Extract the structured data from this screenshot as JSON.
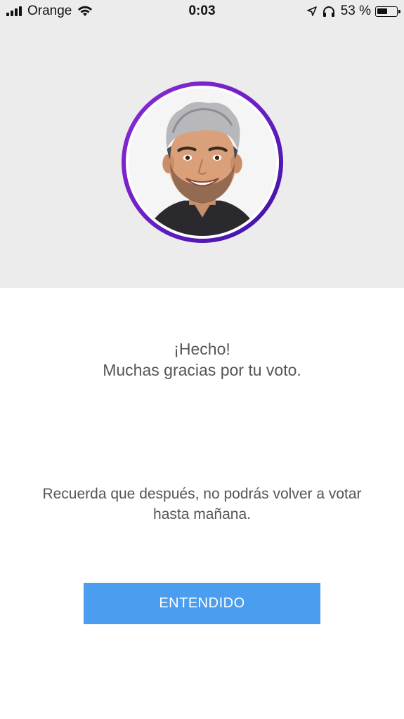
{
  "status_bar": {
    "carrier": "Orange",
    "time": "0:03",
    "battery_percent": "53 %",
    "battery_level": 0.53,
    "icons": [
      "signal-icon",
      "wifi-icon",
      "location-icon",
      "headphones-icon",
      "battery-icon"
    ]
  },
  "header": {
    "avatar_ring_colors": [
      "#8e2ad6",
      "#3a12a0"
    ],
    "background": "#ececec"
  },
  "confirmation": {
    "title": "¡Hecho!",
    "subtitle": "Muchas gracias por tu voto."
  },
  "reminder": {
    "text": "Recuerda que después, no podrás volver a votar hasta mañana."
  },
  "actions": {
    "confirm_label": "ENTENDIDO",
    "confirm_color": "#4a9def"
  }
}
